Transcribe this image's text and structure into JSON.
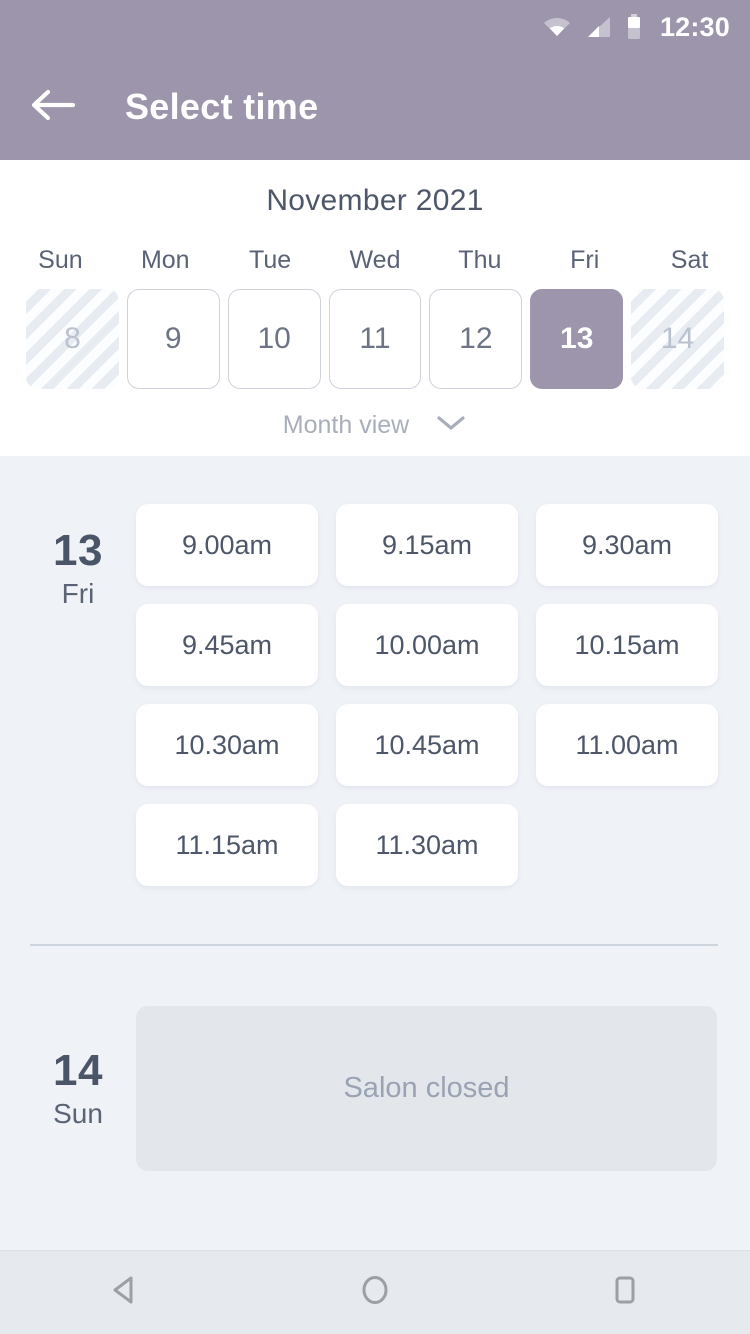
{
  "statusbar": {
    "time": "12:30",
    "icons": [
      "wifi-icon",
      "cellular-signal-icon",
      "battery-icon"
    ]
  },
  "appbar": {
    "title": "Select time",
    "back_icon": "arrow-left-icon"
  },
  "calendar": {
    "month_title": "November 2021",
    "weekdays": [
      "Sun",
      "Mon",
      "Tue",
      "Wed",
      "Thu",
      "Fri",
      "Sat"
    ],
    "days": [
      {
        "num": "8",
        "state": "disabled"
      },
      {
        "num": "9",
        "state": "available"
      },
      {
        "num": "10",
        "state": "available"
      },
      {
        "num": "11",
        "state": "available"
      },
      {
        "num": "12",
        "state": "available"
      },
      {
        "num": "13",
        "state": "selected"
      },
      {
        "num": "14",
        "state": "disabled"
      }
    ],
    "view_toggle_label": "Month view",
    "view_toggle_icon": "chevron-down-icon"
  },
  "schedule": {
    "groups": [
      {
        "day_number": "13",
        "day_of_week": "Fri",
        "slots": [
          "9.00am",
          "9.15am",
          "9.30am",
          "9.45am",
          "10.00am",
          "10.15am",
          "10.30am",
          "10.45am",
          "11.00am",
          "11.15am",
          "11.30am"
        ]
      },
      {
        "day_number": "14",
        "day_of_week": "Sun",
        "closed_label": "Salon closed"
      }
    ]
  },
  "navbar": {
    "back_label": "back-triangle-icon",
    "home_label": "home-circle-icon",
    "recents_label": "recents-square-icon"
  },
  "colors": {
    "accent": "#9c95ac",
    "page_bg": "#eff2f7",
    "panel_bg": "#ffffff",
    "text_dark": "#4a5568",
    "text_muted": "#9aa3b2",
    "closed_bg": "#e3e6eb"
  }
}
